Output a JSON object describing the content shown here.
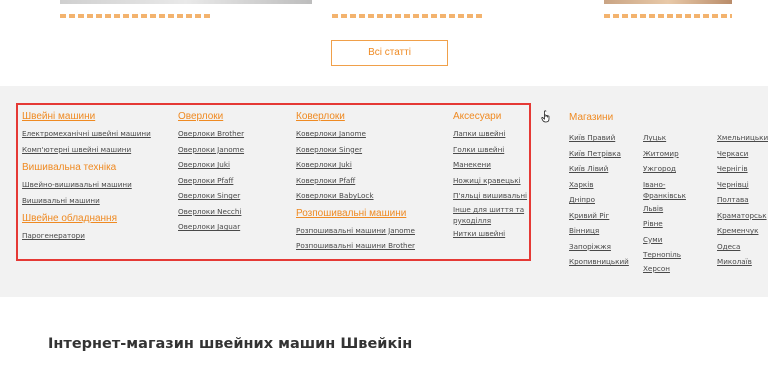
{
  "top": {
    "all_articles_label": "Всі статті"
  },
  "columns": {
    "sewing": {
      "heading": "Швейні машини",
      "links": [
        "Електромеханічні швейні машини",
        "Комп'ютерні швейні машини"
      ]
    },
    "embroidery": {
      "heading": "Вишивальна техніка",
      "links": [
        "Швейно-вишивальні машини",
        "Вишивальні машини"
      ]
    },
    "equipment": {
      "heading": "Швейне обладнання",
      "links": [
        "Парогенератори"
      ]
    },
    "overlocks": {
      "heading": "Оверлоки",
      "links": [
        "Оверлоки Brother",
        "Оверлоки Janome",
        "Оверлоки Juki",
        "Оверлоки Pfaff",
        "Оверлоки Singer",
        "Оверлоки Necchi",
        "Оверлоки Jaguar"
      ]
    },
    "coverlocks": {
      "heading": "Коверлоки",
      "links": [
        "Коверлоки Janome",
        "Коверлоки Singer",
        "Коверлоки Juki",
        "Коверлоки Pfaff",
        "Коверлоки BabyLock"
      ]
    },
    "flatlocks": {
      "heading": "Розпошивальні машини",
      "links": [
        "Розпошивальні машини Janome",
        "Розпошивальні машини Brother"
      ]
    },
    "accessories": {
      "heading": "Аксесуари",
      "links": [
        "Лапки швейні",
        "Голки швейні",
        "Манекени",
        "Ножиці кравецькі",
        "П'яльці вишивальні",
        "Інше для шиття та",
        "рукоділля",
        "Нитки швейні"
      ]
    }
  },
  "stores": {
    "title": "Магазини",
    "col1": [
      "Київ Правий",
      "Київ Петрівка",
      "Київ Лівий",
      "Харків",
      "Дніпро",
      "Кривий Ріг",
      "Вінниця",
      "Запоріжжя",
      "Кропивницький"
    ],
    "col2": [
      "Луцьк",
      "Житомир",
      "Ужгород",
      "Івано-",
      "Франківськ",
      "Львів",
      "Рівне",
      "Суми",
      "Тернопіль",
      "Херсон"
    ],
    "col3": [
      "Хмельницький",
      "Черкаси",
      "Чернігів",
      "Чернівці",
      "Полтава",
      "Краматорськ",
      "Кременчук",
      "Одеса",
      "Миколаїв"
    ]
  },
  "bottom": {
    "title": "Інтернет-магазин швейних машин Швейкін"
  },
  "colors": {
    "accent": "#ef8a22",
    "highlight": "#e53935",
    "footer_bg": "#f2f2f2"
  }
}
